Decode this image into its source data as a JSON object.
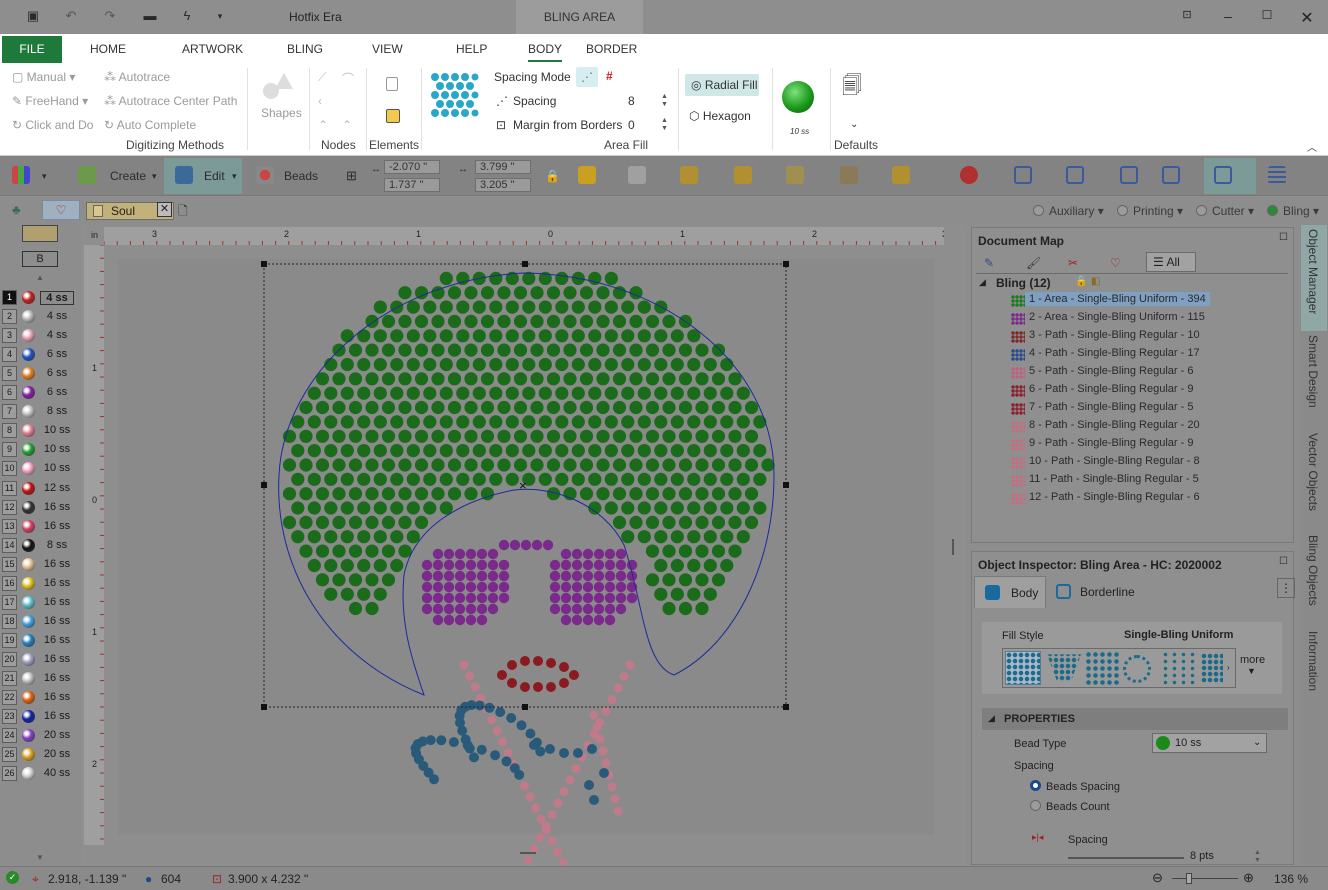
{
  "titlebar": {
    "app_title": "Hotfix Era",
    "context_tab": "BLING AREA"
  },
  "ribbon_tabs": [
    "FILE",
    "HOME",
    "ARTWORK",
    "BLING",
    "VIEW",
    "HELP",
    "BODY",
    "BORDER"
  ],
  "active_tab": "BODY",
  "ribbon": {
    "manual": "Manual",
    "autotrace": "Autotrace",
    "freehand": "FreeHand",
    "autotrace_center": "Autotrace Center Path",
    "click_and_do": "Click and Do",
    "auto_complete": "Auto Complete",
    "digitizing_label": "Digitizing Methods",
    "shapes": "Shapes",
    "nodes_label": "Nodes",
    "elements_label": "Elements",
    "spacing_mode": "Spacing Mode",
    "spacing": "Spacing",
    "spacing_value": "8",
    "margin": "Margin from Borders",
    "margin_value": "0",
    "area_fill_label": "Area Fill",
    "radial_fill": "Radial Fill",
    "hexagon": "Hexagon",
    "bead_size": "10 ss",
    "defaults_label": "Defaults"
  },
  "toolbar": {
    "create": "Create",
    "edit": "Edit",
    "beads": "Beads",
    "x": "-2.070 \"",
    "y": "1.737 \"",
    "w": "3.799 \"",
    "h": "3.205 \""
  },
  "doc": {
    "tab": "Soul"
  },
  "viewbar": {
    "auxiliary": "Auxiliary",
    "printing": "Printing",
    "cutter": "Cutter",
    "bling": "Bling"
  },
  "palette": [
    {
      "n": "1",
      "s": "4 ss",
      "c": "#c02020"
    },
    {
      "n": "2",
      "s": "4 ss",
      "c": "#b8b8b8"
    },
    {
      "n": "3",
      "s": "4 ss",
      "c": "#e6a0b0"
    },
    {
      "n": "4",
      "s": "6 ss",
      "c": "#2050c0"
    },
    {
      "n": "5",
      "s": "6 ss",
      "c": "#e08020"
    },
    {
      "n": "6",
      "s": "6 ss",
      "c": "#8020a0"
    },
    {
      "n": "7",
      "s": "8 ss",
      "c": "#c0c0c0"
    },
    {
      "n": "8",
      "s": "10 ss",
      "c": "#e08090"
    },
    {
      "n": "9",
      "s": "10 ss",
      "c": "#20a030"
    },
    {
      "n": "10",
      "s": "10 ss",
      "c": "#f0a0c0"
    },
    {
      "n": "11",
      "s": "12 ss",
      "c": "#c01010"
    },
    {
      "n": "12",
      "s": "16 ss",
      "c": "#303030"
    },
    {
      "n": "13",
      "s": "16 ss",
      "c": "#d04060"
    },
    {
      "n": "14",
      "s": "8 ss",
      "c": "#101010"
    },
    {
      "n": "15",
      "s": "16 ss",
      "c": "#e0c090"
    },
    {
      "n": "16",
      "s": "16 ss",
      "c": "#e0c020"
    },
    {
      "n": "17",
      "s": "16 ss",
      "c": "#60c0d0"
    },
    {
      "n": "18",
      "s": "16 ss",
      "c": "#40a0e0"
    },
    {
      "n": "19",
      "s": "16 ss",
      "c": "#2080c0"
    },
    {
      "n": "20",
      "s": "16 ss",
      "c": "#a0a0c0"
    },
    {
      "n": "21",
      "s": "16 ss",
      "c": "#c0c0c0"
    },
    {
      "n": "22",
      "s": "16 ss",
      "c": "#e06010"
    },
    {
      "n": "23",
      "s": "16 ss",
      "c": "#1020a0"
    },
    {
      "n": "24",
      "s": "20 ss",
      "c": "#8040c0"
    },
    {
      "n": "25",
      "s": "20 ss",
      "c": "#e0a020"
    },
    {
      "n": "26",
      "s": "40 ss",
      "c": "#d0d0d0"
    }
  ],
  "palette_header": "B",
  "ruler": {
    "unit": "in",
    "top_labels": [
      "3",
      "2",
      "1",
      "0",
      "1",
      "2",
      "3"
    ],
    "left_labels": [
      "1",
      "0",
      "1",
      "2"
    ]
  },
  "document_map": {
    "title": "Document Map",
    "all_tab": "All",
    "group": "Bling (12)",
    "items": [
      {
        "label": "1 - Area - Single-Bling Uniform - 394",
        "color": "#1e7a1e"
      },
      {
        "label": "2 - Area - Single-Bling Uniform - 115",
        "color": "#7a2a8a"
      },
      {
        "label": "3 - Path - Single-Bling Regular - 10",
        "color": "#7a2a2a"
      },
      {
        "label": "4 - Path - Single-Bling Regular - 17",
        "color": "#2a4a8a"
      },
      {
        "label": "5 - Path - Single-Bling Regular - 6",
        "color": "#c06080"
      },
      {
        "label": "6 - Path - Single-Bling Regular - 9",
        "color": "#8a2030"
      },
      {
        "label": "7 - Path - Single-Bling Regular - 5",
        "color": "#8a2030"
      },
      {
        "label": "8 - Path - Single-Bling Regular - 20",
        "color": "#c07080"
      },
      {
        "label": "9 - Path - Single-Bling Regular - 9",
        "color": "#c07080"
      },
      {
        "label": "10 - Path - Single-Bling Regular - 8",
        "color": "#c07080"
      },
      {
        "label": "11 - Path - Single-Bling Regular - 5",
        "color": "#c07080"
      },
      {
        "label": "12 - Path - Single-Bling Regular - 6",
        "color": "#c07080"
      }
    ]
  },
  "inspector": {
    "title": "Object Inspector: Bling Area - HC: 2020002",
    "tab_body": "Body",
    "tab_border": "Borderline",
    "fill_style_label": "Fill Style",
    "fill_style_value": "Single-Bling Uniform",
    "more": "more",
    "properties": "PROPERTIES",
    "bead_type_label": "Bead Type",
    "bead_type_value": "10 ss",
    "spacing_label": "Spacing",
    "beads_spacing": "Beads Spacing",
    "beads_count": "Beads Count",
    "spacing_sub": "Spacing",
    "spacing_pts": "8 pts"
  },
  "side_tabs": [
    "Object Manager",
    "Smart Design",
    "Vector Objects",
    "Bling Objects",
    "Information"
  ],
  "status": {
    "coords": "2.918, -1.139 \"",
    "count": "604",
    "size": "3.900 x 4.232 \"",
    "zoom": "136 %"
  },
  "colors": {
    "ribbon_green": "#1e7a3a",
    "bead_green": "#1a6b1a",
    "bead_purple": "#7a2a8a",
    "bead_red": "#8a1a20",
    "bead_blue": "#2a5a7a",
    "bead_pink": "#c07a8a"
  }
}
